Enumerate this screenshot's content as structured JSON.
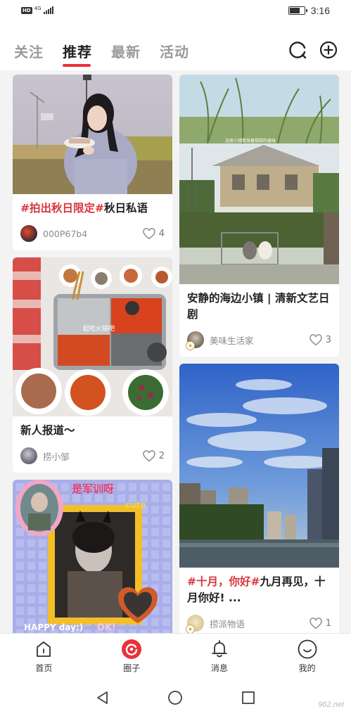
{
  "status_bar": {
    "network": "4G",
    "hd": "HD",
    "time": "3:16",
    "battery_level": 0.75
  },
  "tabs": [
    {
      "label": "关注",
      "active": false
    },
    {
      "label": "推荐",
      "active": true
    },
    {
      "label": "最新",
      "active": false
    },
    {
      "label": "活动",
      "active": false
    }
  ],
  "top_icons": [
    "search-icon",
    "add-icon"
  ],
  "feed": {
    "left": [
      {
        "tag": "#拍出秋日限定#",
        "title": "秋日私语",
        "author": "000P67b4",
        "likes": "4",
        "image": "girl-holding-cake-photo"
      },
      {
        "tag": "",
        "title": "新人报道～",
        "author": "捞小邹",
        "likes": "2",
        "image_caption": "起吃火锅吧",
        "image": "hotpot-photo"
      },
      {
        "tag": "",
        "title": "",
        "author": "",
        "likes": "",
        "image_caption": "是军训呀",
        "image_badge": "cute",
        "image_badge2": "OK!",
        "image_badge3": "HAPPY day:)",
        "image": "military-training-collage"
      }
    ],
    "right": [
      {
        "tag": "",
        "title": "安静的海边小镇 | 清新文艺日剧",
        "author": "美味生活家",
        "likes": "3",
        "image_caption": "这座小镇散发着甜甜的香味",
        "image": "seaside-town-house-photo"
      },
      {
        "tag": "#十月，你好#",
        "title": "九月再见，十月你好! ...",
        "author": "捞派物语",
        "likes": "1",
        "image": "city-sky-photo"
      }
    ]
  },
  "bottom_nav": [
    {
      "label": "首页",
      "icon": "home-icon"
    },
    {
      "label": "圈子",
      "icon": "circle-active-icon"
    },
    {
      "label": "消息",
      "icon": "bell-icon"
    },
    {
      "label": "我的",
      "icon": "smile-icon"
    }
  ],
  "system_nav": [
    "back-icon",
    "home-circle-icon",
    "recents-icon"
  ],
  "watermark": "962.net",
  "colors": {
    "accent": "#e8323c",
    "tag": "#d8353d"
  }
}
